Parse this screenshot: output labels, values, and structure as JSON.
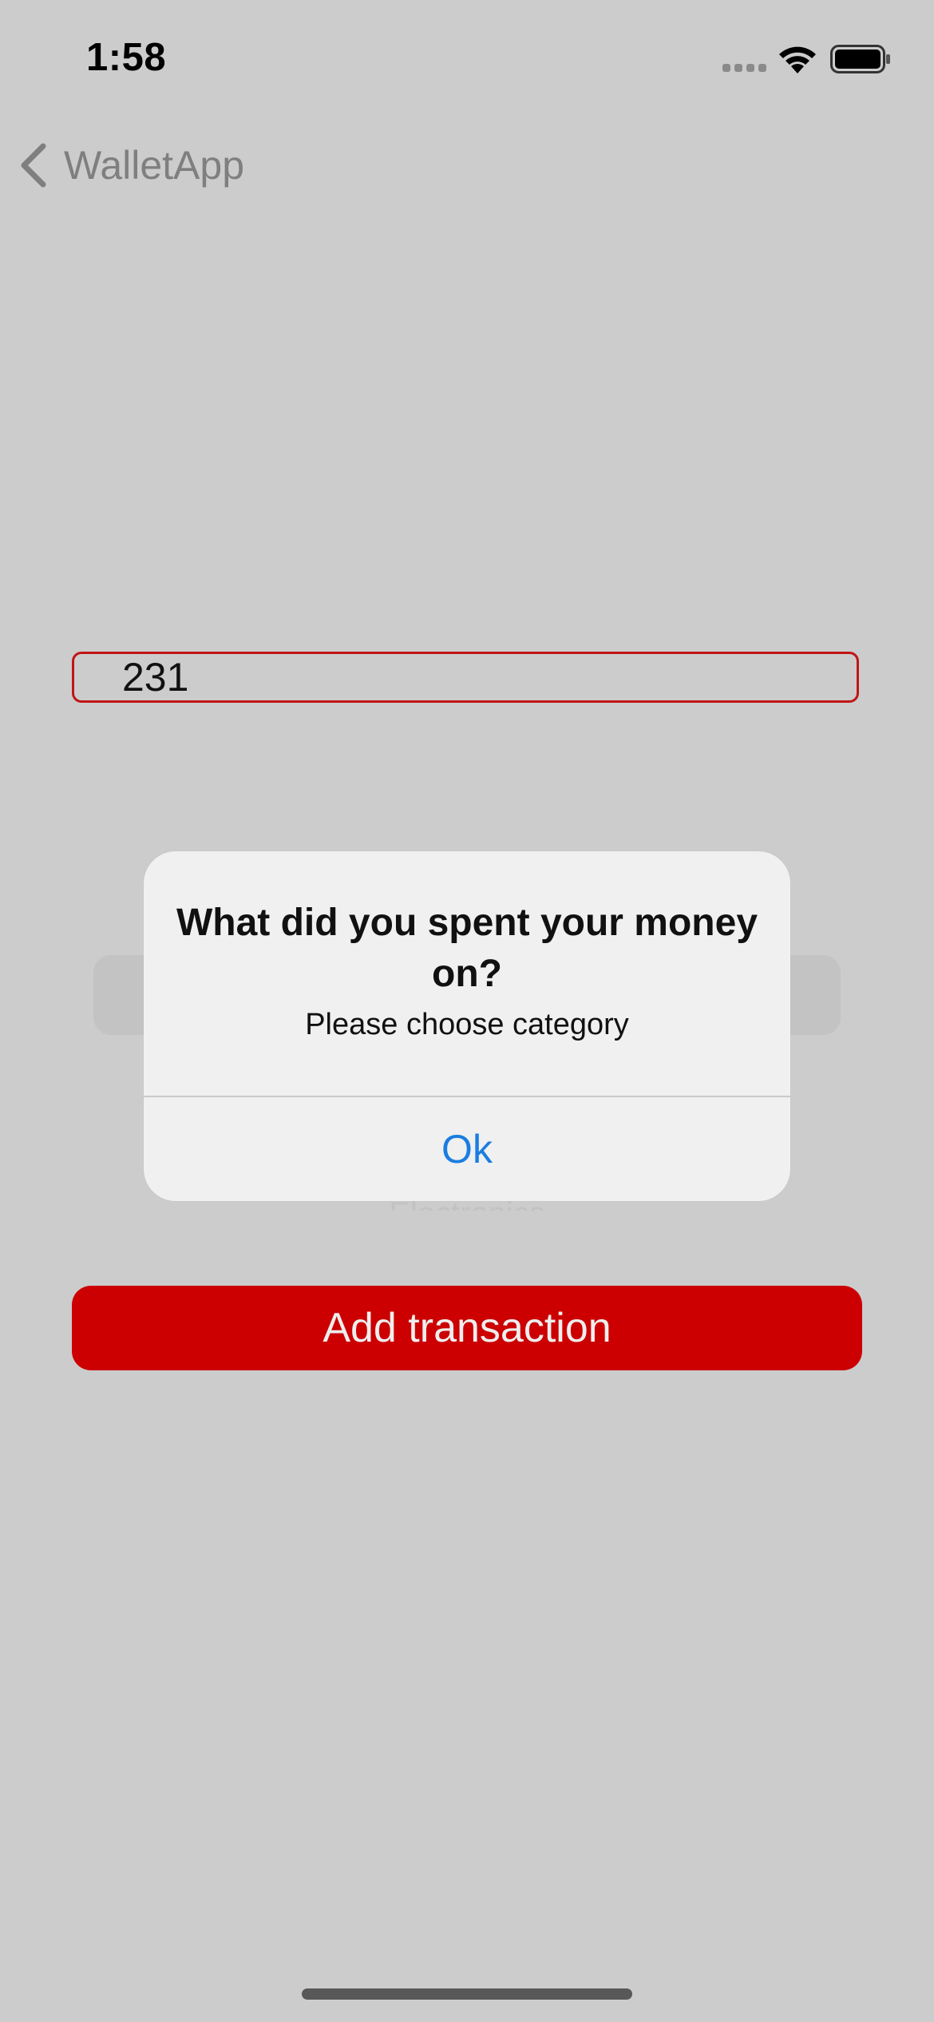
{
  "status_bar": {
    "time": "1:58",
    "signal_icon": "cellular-signal-icon",
    "wifi_icon": "wifi-icon",
    "battery_icon": "battery-icon"
  },
  "nav": {
    "back_icon": "chevron-left-icon",
    "back_label": "WalletApp"
  },
  "form": {
    "amount_value": "231",
    "picker_visible_text": "Electronics",
    "add_button_label": "Add transaction"
  },
  "alert": {
    "title": "What did you spent your money on?",
    "message": "Please choose category",
    "ok_label": "Ok"
  },
  "colors": {
    "background": "#cccccc",
    "accent_red": "#cc0000",
    "input_border": "#c01515",
    "alert_button_blue": "#1a7de0",
    "alert_background": "#f0f0f0"
  }
}
